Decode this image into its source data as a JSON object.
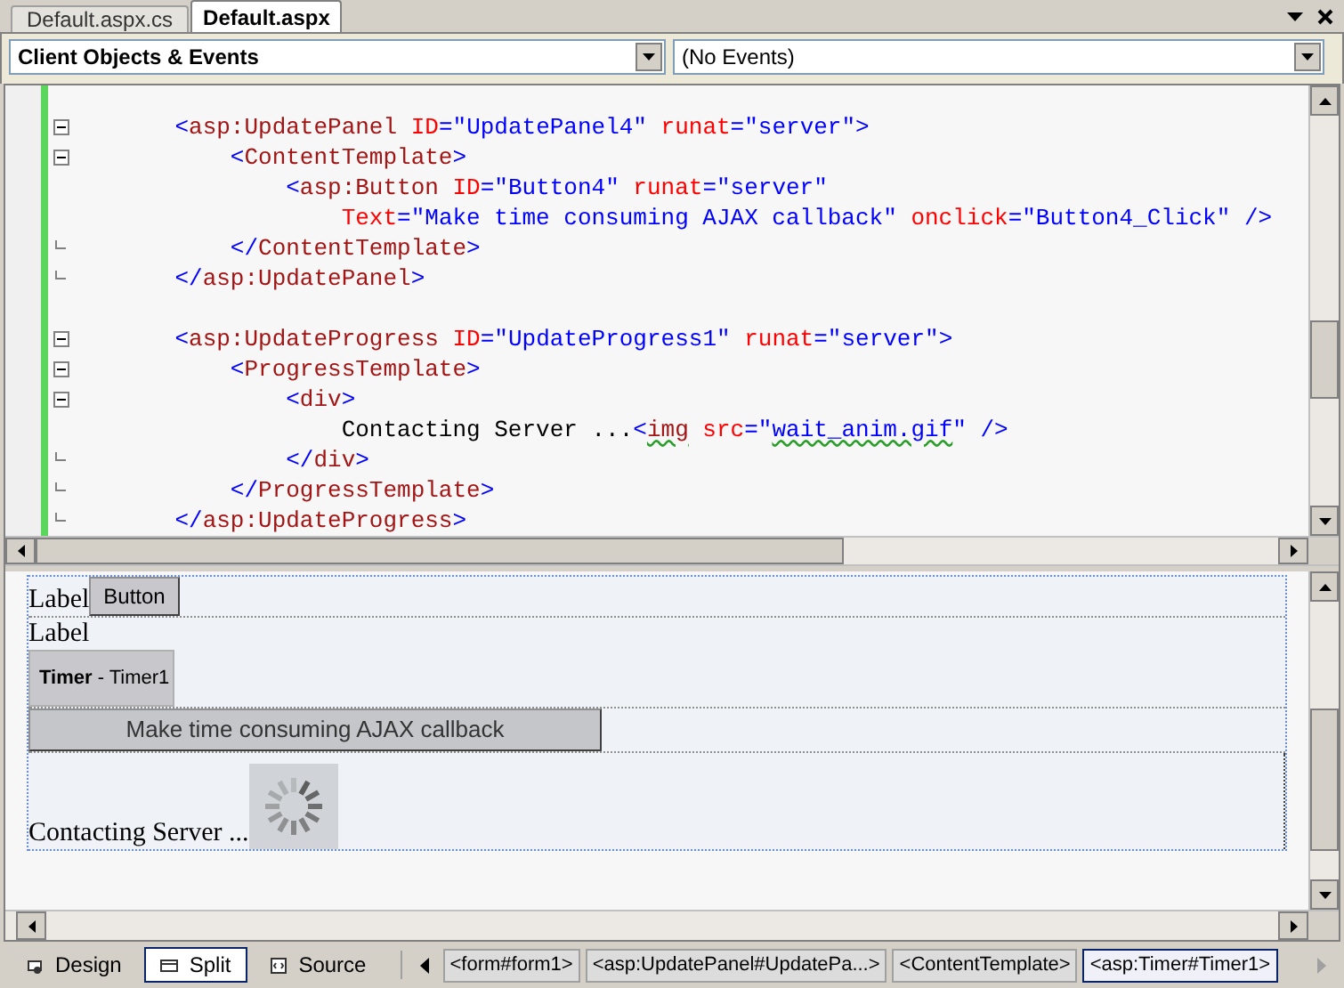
{
  "tabs": [
    {
      "label": "Default.aspx.cs",
      "selected": false
    },
    {
      "label": "Default.aspx",
      "selected": true
    }
  ],
  "dropdowns": [
    {
      "value": "Client Objects & Events"
    },
    {
      "value": "(No Events)"
    }
  ],
  "code": {
    "lines": [
      {
        "collapsible": true,
        "block_end": false,
        "segments": [
          {
            "kind": "bracket",
            "text": "    <"
          },
          {
            "kind": "tag",
            "text": "asp:UpdatePanel"
          },
          {
            "kind": "attr",
            "text": " ID"
          },
          {
            "kind": "bracket",
            "text": "="
          },
          {
            "kind": "value",
            "text": "\"UpdatePanel4\""
          },
          {
            "kind": "attr",
            "text": " runat"
          },
          {
            "kind": "bracket",
            "text": "="
          },
          {
            "kind": "value",
            "text": "\"server\""
          },
          {
            "kind": "bracket",
            "text": ">"
          }
        ]
      },
      {
        "collapsible": true,
        "block_end": false,
        "segments": [
          {
            "kind": "bracket",
            "text": "        <"
          },
          {
            "kind": "tag",
            "text": "ContentTemplate"
          },
          {
            "kind": "bracket",
            "text": ">"
          }
        ]
      },
      {
        "collapsible": false,
        "block_end": false,
        "segments": [
          {
            "kind": "bracket",
            "text": "            <"
          },
          {
            "kind": "tag",
            "text": "asp:Button"
          },
          {
            "kind": "attr",
            "text": " ID"
          },
          {
            "kind": "bracket",
            "text": "="
          },
          {
            "kind": "value",
            "text": "\"Button4\""
          },
          {
            "kind": "attr",
            "text": " runat"
          },
          {
            "kind": "bracket",
            "text": "="
          },
          {
            "kind": "value",
            "text": "\"server\""
          }
        ]
      },
      {
        "collapsible": false,
        "block_end": false,
        "segments": [
          {
            "kind": "attr",
            "text": "                Text"
          },
          {
            "kind": "bracket",
            "text": "="
          },
          {
            "kind": "value",
            "text": "\"Make time consuming AJAX callback\""
          },
          {
            "kind": "attr",
            "text": " onclick"
          },
          {
            "kind": "bracket",
            "text": "="
          },
          {
            "kind": "value",
            "text": "\"Button4_Click\""
          },
          {
            "kind": "bracket",
            "text": " />"
          }
        ]
      },
      {
        "collapsible": false,
        "block_end": true,
        "segments": [
          {
            "kind": "bracket",
            "text": "        </"
          },
          {
            "kind": "tag",
            "text": "ContentTemplate"
          },
          {
            "kind": "bracket",
            "text": ">"
          }
        ]
      },
      {
        "collapsible": false,
        "block_end": true,
        "segments": [
          {
            "kind": "bracket",
            "text": "    </"
          },
          {
            "kind": "tag",
            "text": "asp:UpdatePanel"
          },
          {
            "kind": "bracket",
            "text": ">"
          }
        ]
      },
      {
        "collapsible": false,
        "block_end": false
      },
      {
        "collapsible": true,
        "block_end": false,
        "segments": [
          {
            "kind": "bracket",
            "text": "    <"
          },
          {
            "kind": "tag",
            "text": "asp:UpdateProgress"
          },
          {
            "kind": "attr",
            "text": " ID"
          },
          {
            "kind": "bracket",
            "text": "="
          },
          {
            "kind": "value",
            "text": "\"UpdateProgress1\""
          },
          {
            "kind": "attr",
            "text": " runat"
          },
          {
            "kind": "bracket",
            "text": "="
          },
          {
            "kind": "value",
            "text": "\"server\""
          },
          {
            "kind": "bracket",
            "text": ">"
          }
        ]
      },
      {
        "collapsible": true,
        "block_end": false,
        "segments": [
          {
            "kind": "bracket",
            "text": "        <"
          },
          {
            "kind": "tag",
            "text": "ProgressTemplate"
          },
          {
            "kind": "bracket",
            "text": ">"
          }
        ]
      },
      {
        "collapsible": true,
        "block_end": false,
        "segments": [
          {
            "kind": "bracket",
            "text": "            <"
          },
          {
            "kind": "tag",
            "text": "div"
          },
          {
            "kind": "bracket",
            "text": ">"
          }
        ]
      },
      {
        "collapsible": false,
        "block_end": false,
        "segments": [
          {
            "kind": "text",
            "text": "                Contacting Server ..."
          },
          {
            "kind": "bracket",
            "text": "<"
          },
          {
            "kind": "tag",
            "text": "img",
            "squiggle": true
          },
          {
            "kind": "attr",
            "text": " src"
          },
          {
            "kind": "bracket",
            "text": "="
          },
          {
            "kind": "value",
            "text": "\""
          },
          {
            "kind": "value",
            "text": "wait_anim.gif",
            "squiggle": true
          },
          {
            "kind": "value",
            "text": "\""
          },
          {
            "kind": "bracket",
            "text": " />"
          }
        ]
      },
      {
        "collapsible": false,
        "block_end": true,
        "segments": [
          {
            "kind": "bracket",
            "text": "            </"
          },
          {
            "kind": "tag",
            "text": "div"
          },
          {
            "kind": "bracket",
            "text": ">"
          }
        ]
      },
      {
        "collapsible": false,
        "block_end": true,
        "segments": [
          {
            "kind": "bracket",
            "text": "        </"
          },
          {
            "kind": "tag",
            "text": "ProgressTemplate"
          },
          {
            "kind": "bracket",
            "text": ">"
          }
        ]
      },
      {
        "collapsible": false,
        "block_end": true,
        "segments": [
          {
            "kind": "bracket",
            "text": "    </"
          },
          {
            "kind": "tag",
            "text": "asp:UpdateProgress"
          },
          {
            "kind": "bracket",
            "text": ">"
          }
        ]
      }
    ]
  },
  "design": {
    "rows": [
      {
        "items": [
          {
            "kind": "label",
            "text": "Label"
          },
          {
            "kind": "button",
            "text": "Button"
          }
        ]
      },
      {
        "items": [
          {
            "kind": "label",
            "text": "Label"
          },
          {
            "kind": "timer",
            "title": "Timer",
            "text": " - Timer1"
          }
        ]
      },
      {
        "items": [
          {
            "kind": "wide-button",
            "text": "Make time consuming AJAX callback"
          }
        ]
      },
      {
        "items": [
          {
            "kind": "label",
            "text": "Contacting Server ..."
          },
          {
            "kind": "spinner"
          }
        ]
      }
    ]
  },
  "views": [
    {
      "label": "Design",
      "selected": false
    },
    {
      "label": "Split",
      "selected": true
    },
    {
      "label": "Source",
      "selected": false
    }
  ],
  "breadcrumbs": [
    {
      "label": "<form#form1>",
      "selected": false
    },
    {
      "label": "<asp:UpdatePanel#UpdatePa...>",
      "selected": false
    },
    {
      "label": "<ContentTemplate>",
      "selected": false
    },
    {
      "label": "<asp:Timer#Timer1>",
      "selected": true
    }
  ]
}
